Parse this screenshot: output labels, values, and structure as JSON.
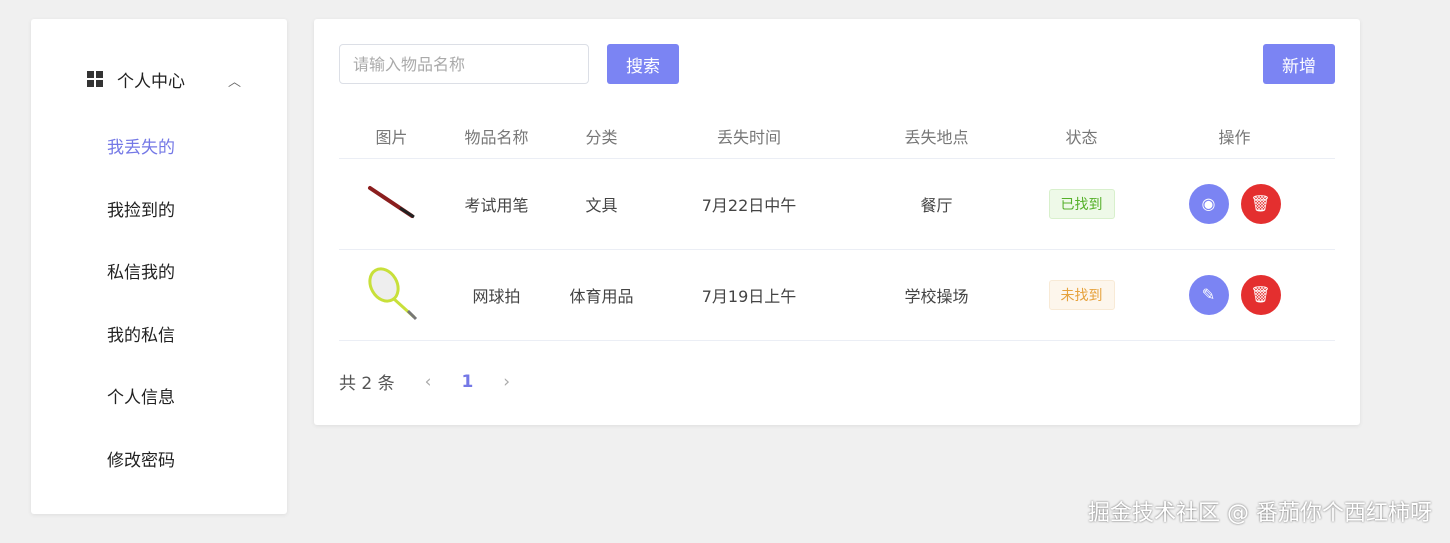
{
  "sidebar": {
    "menu_title": "个人中心",
    "items": [
      {
        "label": "我丢失的",
        "active": true
      },
      {
        "label": "我捡到的"
      },
      {
        "label": "私信我的"
      },
      {
        "label": "我的私信"
      },
      {
        "label": "个人信息"
      },
      {
        "label": "修改密码"
      }
    ]
  },
  "toolbar": {
    "search_placeholder": "请输入物品名称",
    "search_value": "",
    "search_label": "搜索",
    "add_label": "新增"
  },
  "table": {
    "headers": [
      "图片",
      "物品名称",
      "分类",
      "丢失时间",
      "丢失地点",
      "状态",
      "操作"
    ],
    "rows": [
      {
        "image": "pen-image",
        "name": "考试用笔",
        "category": "文具",
        "time": "7月22日中午",
        "place": "餐厅",
        "status": "已找到",
        "action1": "view-icon"
      },
      {
        "image": "racket-image",
        "name": "网球拍",
        "category": "体育用品",
        "time": "7月19日上午",
        "place": "学校操场",
        "status": "未找到",
        "action1": "edit-icon"
      }
    ]
  },
  "pagination": {
    "total": "共 2 条",
    "current": "1"
  },
  "watermark": "掘金技术社区 @ 番茄你个西红柿呀",
  "colors": {
    "accent": "#7b84f3",
    "danger": "#e42f2f"
  }
}
